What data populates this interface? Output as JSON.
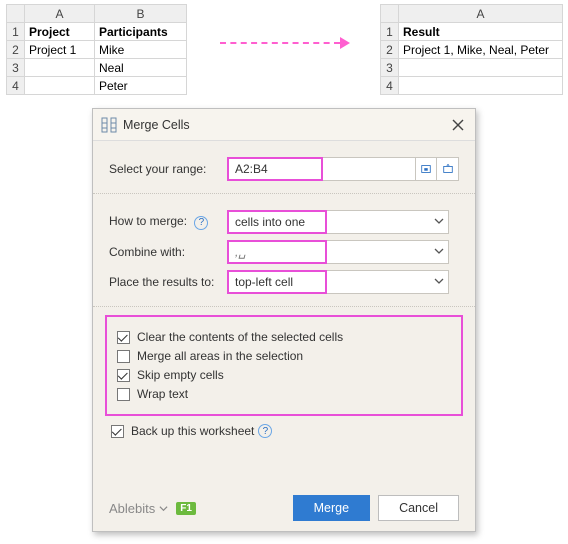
{
  "sheet_left": {
    "columns": [
      "A",
      "B"
    ],
    "headers": [
      "Project",
      "Participants"
    ],
    "rows": [
      {
        "n": "1",
        "a": "Project",
        "b": "Participants"
      },
      {
        "n": "2",
        "a": "Project 1",
        "b": "Mike"
      },
      {
        "n": "3",
        "a": "",
        "b": "Neal"
      },
      {
        "n": "4",
        "a": "",
        "b": "Peter"
      }
    ]
  },
  "sheet_right": {
    "columns": [
      "A"
    ],
    "rows": [
      {
        "n": "1",
        "a": "Result"
      },
      {
        "n": "2",
        "a": "Project 1, Mike, Neal, Peter"
      },
      {
        "n": "3",
        "a": ""
      },
      {
        "n": "4",
        "a": ""
      }
    ]
  },
  "dialog": {
    "title": "Merge Cells",
    "section_range": {
      "label": "Select your range:",
      "value": "A2:B4"
    },
    "section_how": {
      "label": "How to merge:",
      "value": "cells into one"
    },
    "section_combine": {
      "label": "Combine with:",
      "value": ",␣"
    },
    "section_place": {
      "label": "Place the results to:",
      "value": "top-left cell"
    },
    "checks": {
      "clear": "Clear the contents of the selected cells",
      "merge_areas": "Merge all areas in the selection",
      "skip": "Skip empty cells",
      "wrap": "Wrap text"
    },
    "backup": "Back up this worksheet",
    "brand": "Ablebits",
    "f1": "F1",
    "merge_btn": "Merge",
    "cancel_btn": "Cancel"
  }
}
